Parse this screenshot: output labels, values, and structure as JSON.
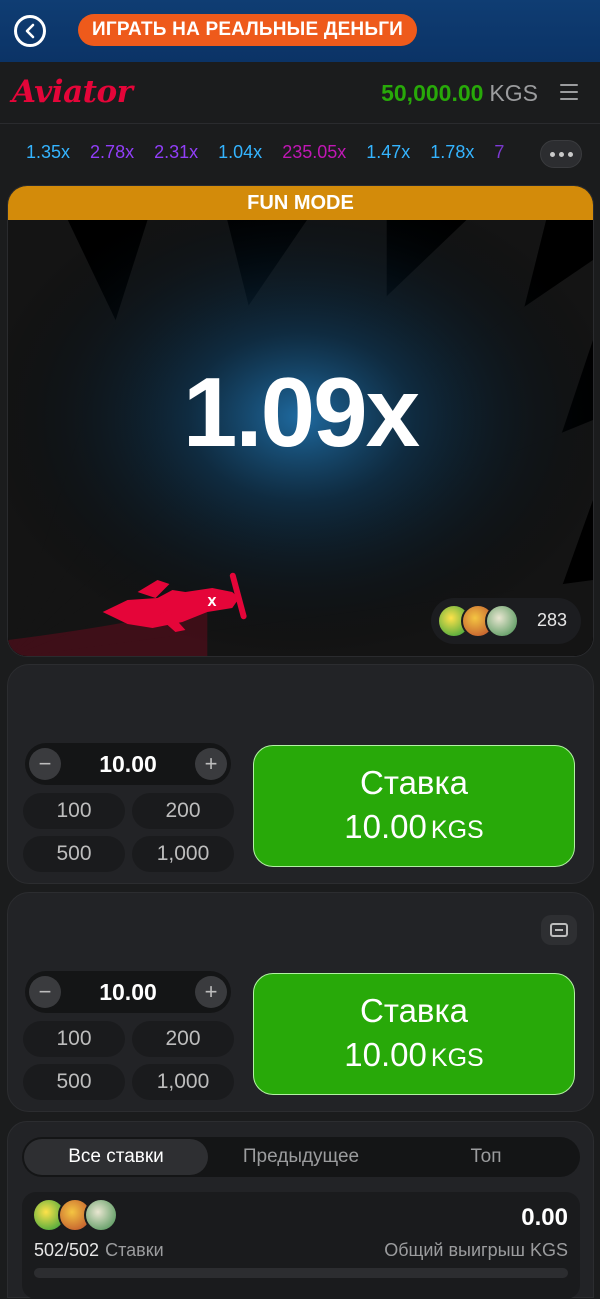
{
  "topbar": {
    "promo_label": "ИГРАТЬ НА РЕАЛЬНЫЕ ДЕНЬГИ"
  },
  "header": {
    "logo": "Aviator",
    "balance_amount": "50,000.00",
    "balance_currency": "KGS"
  },
  "history": {
    "items": [
      {
        "value": "1.35x",
        "color": "#34b4ff"
      },
      {
        "value": "2.78x",
        "color": "#913ef8"
      },
      {
        "value": "2.31x",
        "color": "#913ef8"
      },
      {
        "value": "1.04x",
        "color": "#34b4ff"
      },
      {
        "value": "235.05x",
        "color": "#c017b4"
      },
      {
        "value": "1.47x",
        "color": "#34b4ff"
      },
      {
        "value": "1.78x",
        "color": "#34b4ff"
      },
      {
        "value": "7",
        "color": "#913ef8"
      }
    ]
  },
  "game": {
    "mode_banner": "FUN MODE",
    "multiplier": "1.09x",
    "players_count": "283"
  },
  "bet_panels": [
    {
      "amount": "10.00",
      "quick": [
        "100",
        "200",
        "500",
        "1,000"
      ],
      "button_label": "Ставка",
      "button_amount": "10.00",
      "button_currency": "KGS"
    },
    {
      "amount": "10.00",
      "quick": [
        "100",
        "200",
        "500",
        "1,000"
      ],
      "button_label": "Ставка",
      "button_amount": "10.00",
      "button_currency": "KGS"
    }
  ],
  "bets": {
    "tabs": [
      "Все ставки",
      "Предыдущее",
      "Топ"
    ],
    "active_tab": "Все ставки",
    "bets_count": "502/502",
    "bets_label": "Ставки",
    "total_win": "0.00",
    "total_win_label": "Общий выигрыш KGS"
  },
  "colors": {
    "accent_green": "#28a909",
    "brand_red": "#e50539",
    "fun_mode_orange": "#d38b0a",
    "promo_orange": "#ee5a1b"
  }
}
